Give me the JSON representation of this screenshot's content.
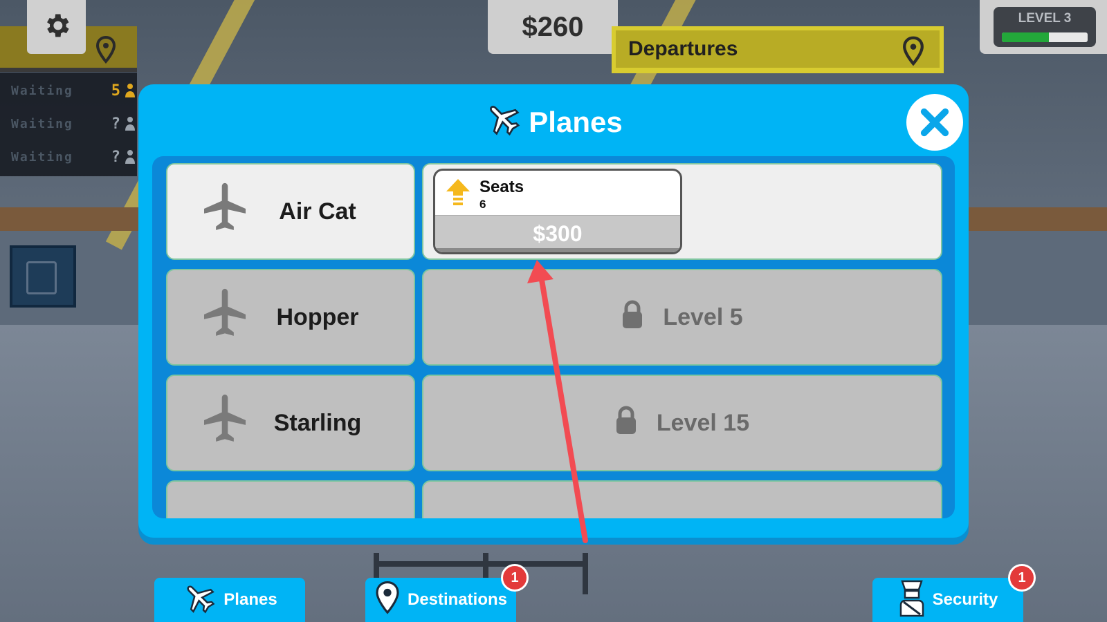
{
  "hud": {
    "money": "$260",
    "departures_label": "Departures",
    "level_label": "LEVEL 3",
    "level_progress": 0.55,
    "waiting": [
      {
        "label": "Waiting",
        "count": "5"
      },
      {
        "label": "Waiting",
        "count": "?"
      },
      {
        "label": "Waiting",
        "count": "?"
      }
    ]
  },
  "modal": {
    "title": "Planes",
    "planes": [
      {
        "name": "Air Cat",
        "state": "unlocked",
        "upgrade_label": "Seats",
        "upgrade_value": "6",
        "price": "$300"
      },
      {
        "name": "Hopper",
        "state": "locked",
        "lock_text": "Level 5"
      },
      {
        "name": "Starling",
        "state": "locked",
        "lock_text": "Level 15"
      }
    ]
  },
  "tabs": {
    "planes_label": "Planes",
    "destinations_label": "Destinations",
    "destinations_badge": "1",
    "security_label": "Security",
    "security_badge": "1"
  },
  "colors": {
    "modal_bg": "#00b4f5",
    "list_bg": "#0b88d8",
    "badge": "#e33a3a",
    "arrow": "#f24b52",
    "level_fill": "#23a83a"
  },
  "icons": {
    "settings": "gear-icon",
    "location": "map-pin-icon",
    "plane": "airplane-icon",
    "lock": "lock-icon",
    "upgrade": "arrow-up-icon",
    "close": "close-icon",
    "security": "security-guard-icon"
  }
}
